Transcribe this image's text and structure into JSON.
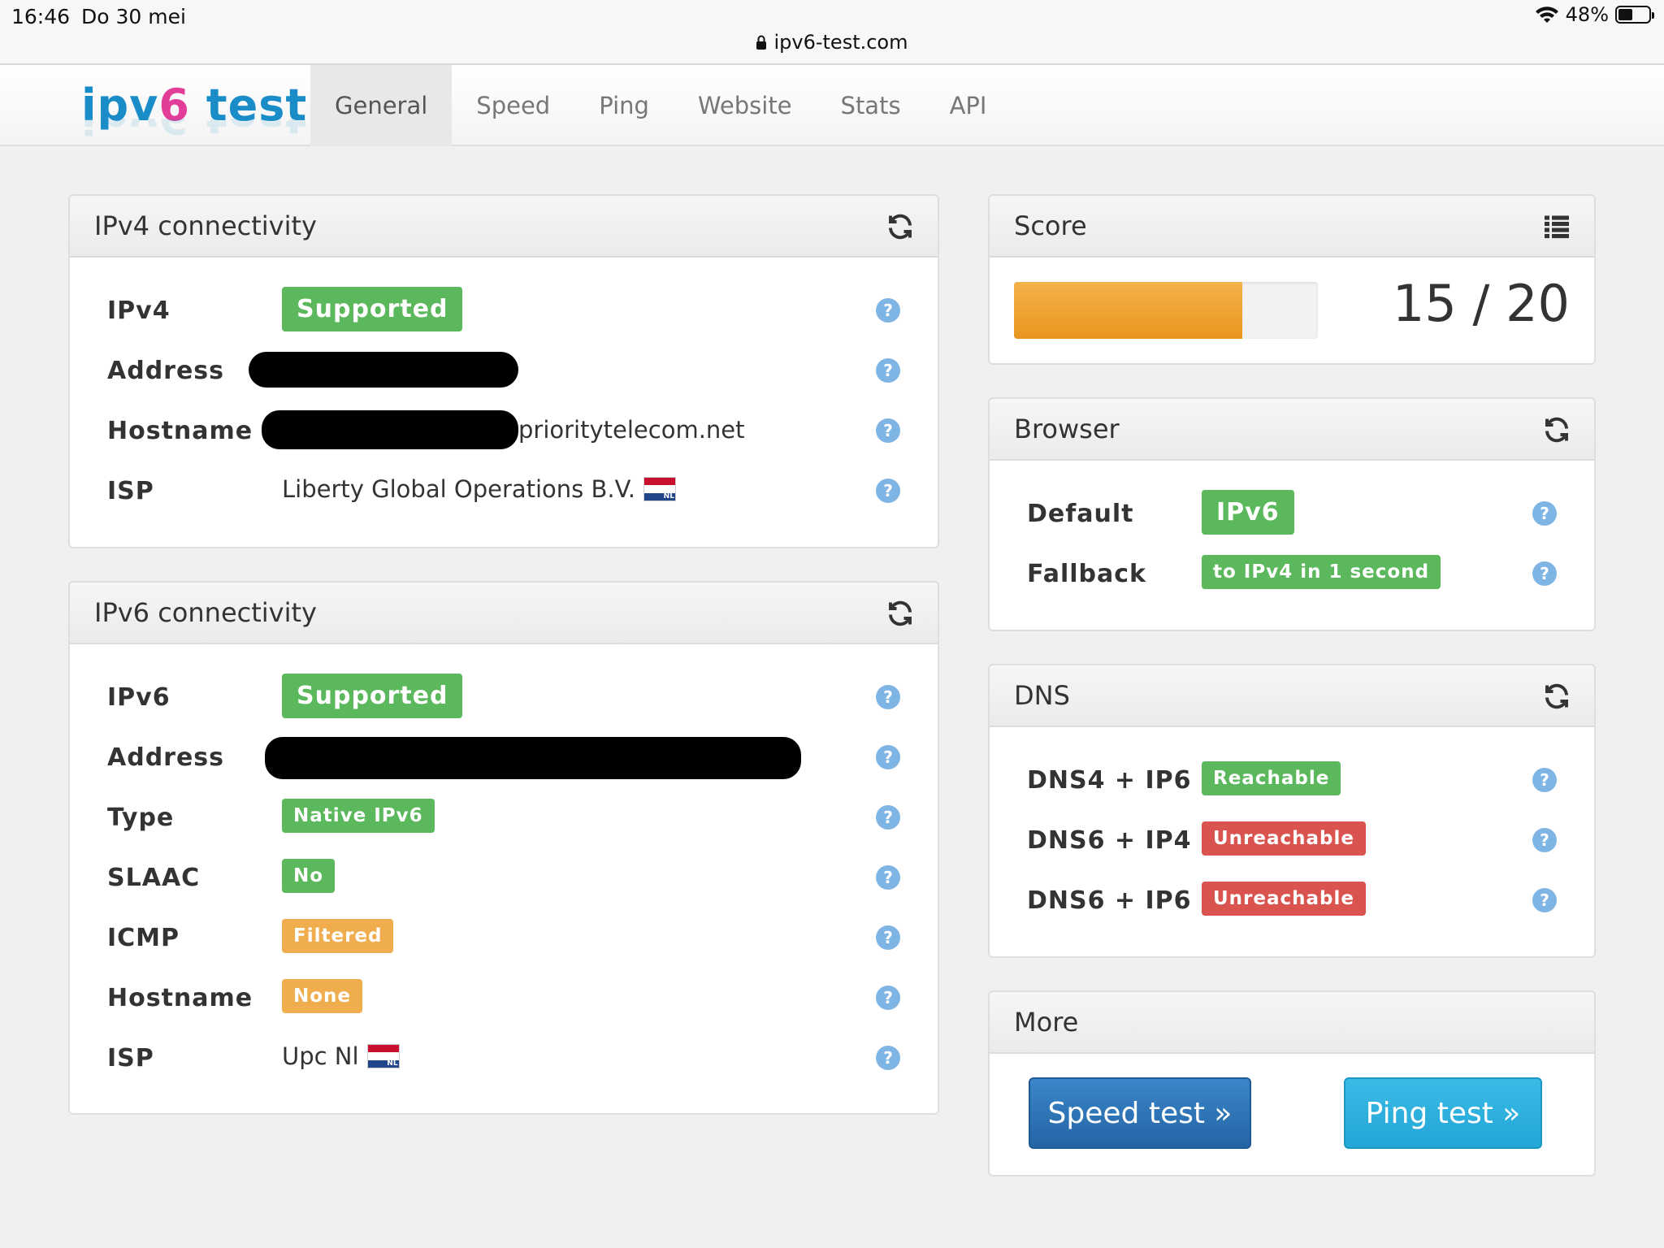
{
  "status_bar": {
    "time": "16:46",
    "date": "Do 30 mei",
    "battery": "48%",
    "battery_level": 0.48
  },
  "browser": {
    "url": "ipv6-test.com"
  },
  "site": {
    "logo_part1": "ipv",
    "logo_part2": "6",
    "logo_part3": " test",
    "tabs": [
      "General",
      "Speed",
      "Ping",
      "Website",
      "Stats",
      "API"
    ],
    "active_tab": "General"
  },
  "ipv4": {
    "title": "IPv4 connectivity",
    "rows": [
      {
        "label": "IPv4",
        "value": "Supported"
      },
      {
        "label": "Address",
        "value": ""
      },
      {
        "label": "Hostname",
        "value": "prioritytelecom.net"
      },
      {
        "label": "ISP",
        "value": "Liberty Global Operations B.V."
      }
    ]
  },
  "ipv6": {
    "title": "IPv6 connectivity",
    "rows": [
      {
        "label": "IPv6",
        "value": "Supported"
      },
      {
        "label": "Address",
        "value": ""
      },
      {
        "label": "Type",
        "value": "Native IPv6"
      },
      {
        "label": "SLAAC",
        "value": "No"
      },
      {
        "label": "ICMP",
        "value": "Filtered"
      },
      {
        "label": "Hostname",
        "value": "None"
      },
      {
        "label": "ISP",
        "value": "Upc Nl"
      }
    ]
  },
  "flag_label": "NL",
  "score": {
    "title": "Score",
    "value": "15 / 20",
    "fraction": 0.75
  },
  "browser_panel": {
    "title": "Browser",
    "rows": [
      {
        "label": "Default",
        "value": "IPv6"
      },
      {
        "label": "Fallback",
        "value": "to IPv4 in 1 second"
      }
    ]
  },
  "dns": {
    "title": "DNS",
    "rows": [
      {
        "label": "DNS4 + IP6",
        "value": "Reachable"
      },
      {
        "label": "DNS6 + IP4",
        "value": "Unreachable"
      },
      {
        "label": "DNS6 + IP6",
        "value": "Unreachable"
      }
    ]
  },
  "more": {
    "title": "More",
    "speed_button": "Speed test »",
    "ping_button": "Ping test »"
  },
  "colors": {
    "green": "#5cb85c",
    "orange": "#f0ad4e",
    "red": "#d9534f",
    "blue": "#2a6bb0",
    "cyan": "#29abe0"
  },
  "help_glyph": "?"
}
